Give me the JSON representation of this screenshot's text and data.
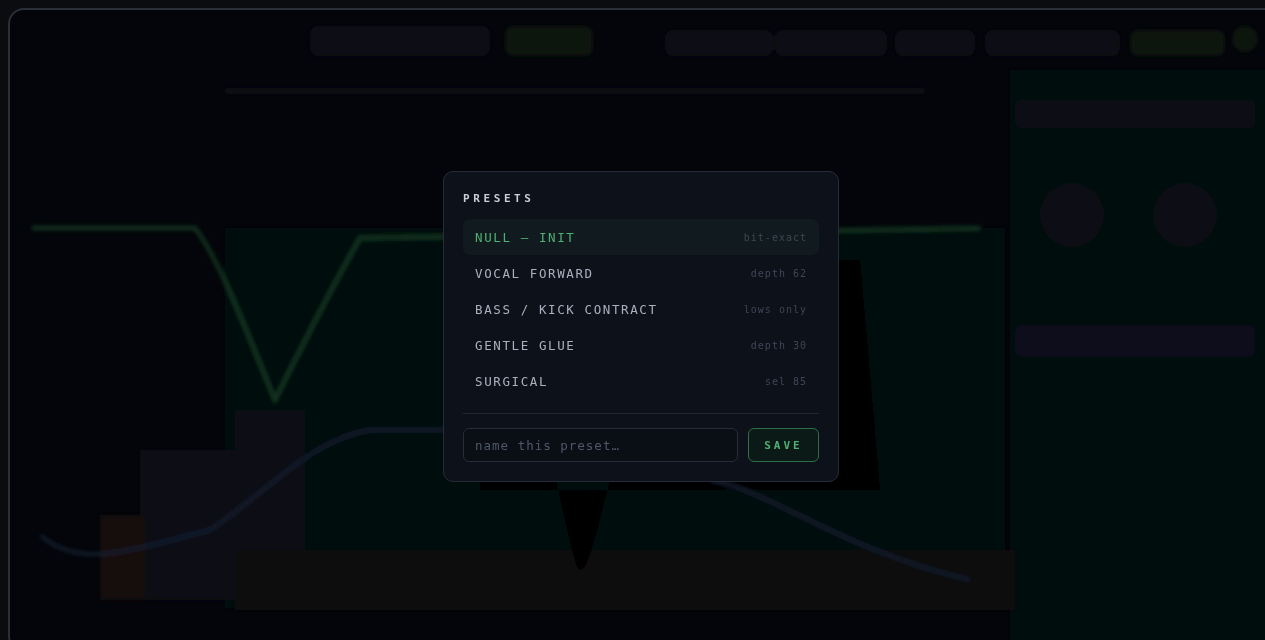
{
  "presets_dialog": {
    "title": "PRESETS",
    "presets": [
      {
        "name": "NULL — INIT",
        "note": "bit-exact",
        "selected": true
      },
      {
        "name": "VOCAL FORWARD",
        "note": "depth 62",
        "selected": false
      },
      {
        "name": "BASS / KICK CONTRACT",
        "note": "lows only",
        "selected": false
      },
      {
        "name": "GENTLE GLUE",
        "note": "depth 30",
        "selected": false
      },
      {
        "name": "SURGICAL",
        "note": "sel 85",
        "selected": false
      }
    ],
    "name_field": {
      "placeholder": "name this preset…"
    },
    "save_button": "SAVE"
  }
}
